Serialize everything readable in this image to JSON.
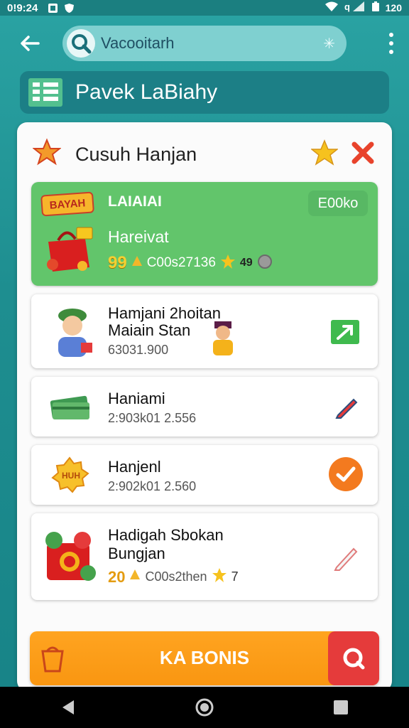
{
  "status_bar": {
    "time": "0!9:24",
    "battery_text": "120"
  },
  "app_bar": {
    "search": {
      "value": "Vacooitarh"
    }
  },
  "banner": {
    "title": "Pavek LaBiahy"
  },
  "card": {
    "title": "Cusuh Hanjan",
    "featured": {
      "tag": "BAYAH",
      "label": "LAIAIAI",
      "pill": "E00ko",
      "subtitle": "Hareivat",
      "coins": "99",
      "code": "C00s27136",
      "extra": "49"
    },
    "items": [
      {
        "title_line1": "Hamjani 2hoitan",
        "title_line2": "Maiain Stan",
        "sub": "63031.900",
        "action_icon": "trend-up-icon"
      },
      {
        "title_line1": "Haniami",
        "title_line2": "",
        "sub": "2:903k01 2.556",
        "action_icon": "pencil-icon"
      },
      {
        "title_line1": "Hanjenl",
        "title_line2": "",
        "sub": "2:902k01 2.560",
        "action_icon": "check-icon"
      },
      {
        "title_line1": "Hadigah Sbokan",
        "title_line2": "Bungjan",
        "coins": "20",
        "sub": "C00s2then",
        "extra": "7",
        "action_icon": "pencil-icon"
      }
    ]
  },
  "bonus_button": {
    "label": "KA BONIS"
  },
  "colors": {
    "teal": "#1e8e90",
    "green": "#62c56b",
    "orange": "#f99611",
    "red": "#e53b3b"
  }
}
